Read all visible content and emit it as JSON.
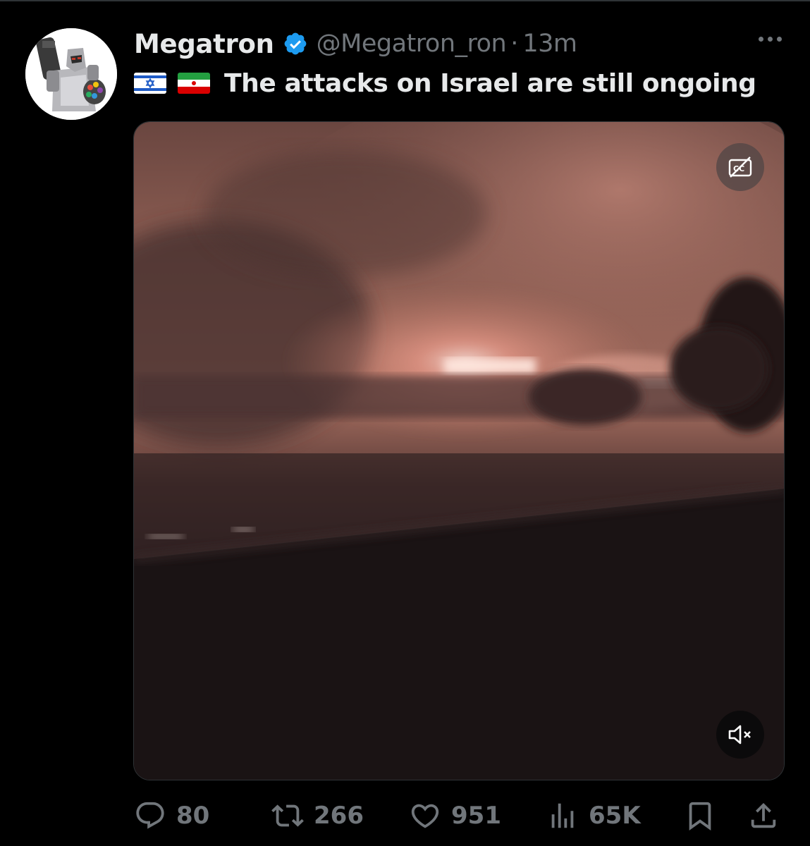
{
  "author": {
    "name": "Megatron",
    "handle": "@Megatron_ron",
    "separator": "·",
    "time": "13m"
  },
  "post": {
    "text": "The attacks on Israel are still ongoing",
    "flags": [
      "israel-flag-icon",
      "iran-flag-icon"
    ]
  },
  "media": {
    "type": "video",
    "controls": [
      "captions-off-icon",
      "volume-muted-icon"
    ]
  },
  "actions": {
    "replies": "80",
    "reposts": "266",
    "likes": "951",
    "views": "65K"
  },
  "colors": {
    "background": "#000000",
    "text": "#e7e9ea",
    "muted": "#71767b",
    "verified": "#1d9bf0"
  }
}
